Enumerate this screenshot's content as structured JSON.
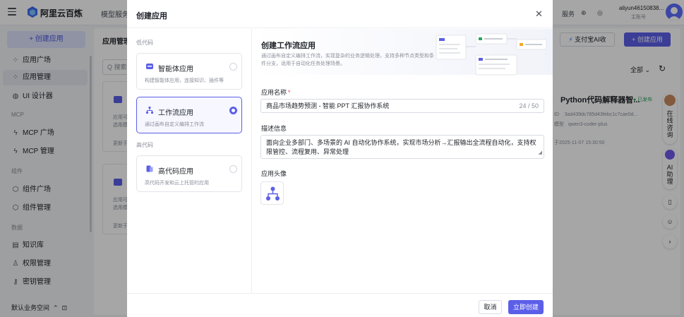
{
  "topbar": {
    "brand": "阿里云百炼",
    "nav_item": "模型服务",
    "service_label": "服务",
    "user_name": "aliyun46150838...",
    "user_role": "主账号"
  },
  "sidebar": {
    "create_button": "+ 创建应用",
    "items": [
      {
        "label": "应用广场",
        "icon": "grid-icon"
      },
      {
        "label": "应用管理",
        "icon": "grid-icon"
      },
      {
        "label": "UI 设计器",
        "icon": "palette-icon"
      },
      {
        "label": "MCP 广场",
        "icon": "mcp-icon"
      },
      {
        "label": "MCP 管理",
        "icon": "mcp-icon"
      },
      {
        "label": "组件广场",
        "icon": "component-icon"
      },
      {
        "label": "组件管理",
        "icon": "component-icon"
      },
      {
        "label": "知识库",
        "icon": "book-icon"
      },
      {
        "label": "权限管理",
        "icon": "user-icon"
      },
      {
        "label": "密钥管理",
        "icon": "key-icon"
      }
    ],
    "sections": [
      "MCP",
      "组件",
      "数据"
    ],
    "workspace": "默认业务空间"
  },
  "background": {
    "title": "应用管理",
    "search_placeholder": "Q 搜索",
    "alipay_button": "支付宝AI收",
    "create_button": "+ 创建应用",
    "filter": "全部",
    "card_texts": [
      "应用可...",
      "选用模...",
      "更新于"
    ],
    "right_card": {
      "title": "Python代码解释器智...",
      "status": "● 已发布",
      "id_label": "ID",
      "id_value": "3ad439dc785d43febc1c7cae0d...",
      "model_label": "模型",
      "model_value": "qwen3-coder-plus",
      "updated": "于2025-11-07 15:30:50"
    },
    "float_tools": {
      "consult": "在线咨询",
      "assistant": "AI助理"
    }
  },
  "modal": {
    "title": "创建应用",
    "low_code_label": "低代码",
    "high_code_label": "高代码",
    "options": [
      {
        "title": "智能体应用",
        "desc": "构建智能体应用，连接知识、插件等",
        "selected": false
      },
      {
        "title": "工作流应用",
        "desc": "通过画布自定义编排工作流",
        "selected": true
      },
      {
        "title": "高代码应用",
        "desc": "高代码开发和云上托管的应用",
        "selected": false
      }
    ],
    "hero": {
      "title": "创建工作流应用",
      "desc": "通过画布自定义编排工作流，实现复杂的业务逻辑处理，支持多种节点类型和条件分支，适用于自动化任务处理场景。"
    },
    "name_label": "应用名称",
    "name_value": "商品市场趋势预测 - 智能 PPT 汇报协作系统",
    "name_count": "24 / 50",
    "desc_label": "描述信息",
    "desc_value": "面向企业多部门、多场景的 AI 自动化协作系统，实现市场分析→汇报输出全流程自动化，支持权限管控、流程复用、异常处理",
    "avatar_label": "应用头像",
    "cancel": "取消",
    "submit": "立即创建"
  },
  "colors": {
    "accent": "#5b5fe8",
    "accent_light": "#dde2fc",
    "status_green": "#29a55e",
    "required": "#e5484d"
  }
}
